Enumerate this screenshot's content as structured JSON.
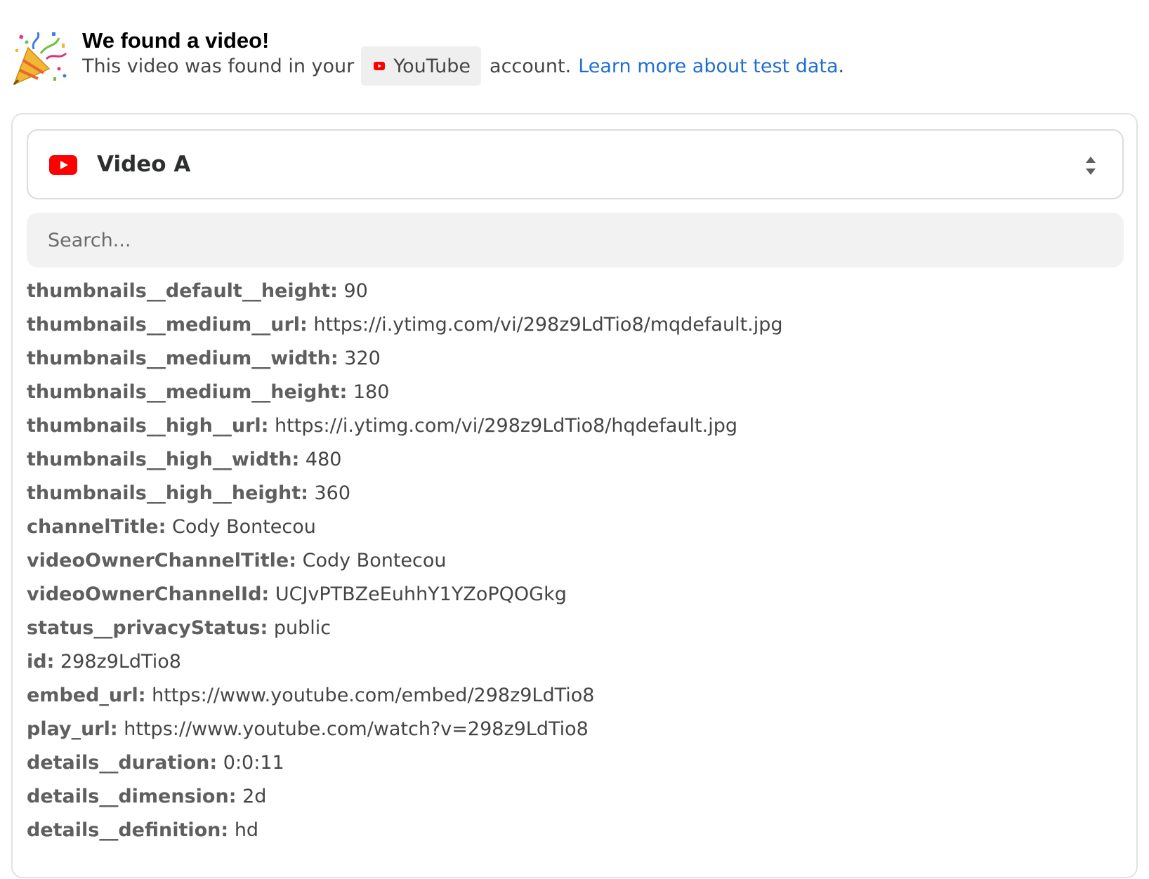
{
  "header": {
    "title": "We found a video!",
    "subtitle_prefix": "This video was found in your",
    "app_name": "YouTube",
    "subtitle_suffix": "account.",
    "link_text": "Learn more about test data",
    "link_period": ".",
    "icon": "party-popper-icon"
  },
  "selector": {
    "value": "Video A",
    "icon": "youtube-icon",
    "toggle_icon": "sort-arrows-icon"
  },
  "search": {
    "placeholder": "Search..."
  },
  "fields": [
    {
      "key": "thumbnails__default__height:",
      "value": "90"
    },
    {
      "key": "thumbnails__medium__url:",
      "value": "https://i.ytimg.com/vi/298z9LdTio8/mqdefault.jpg"
    },
    {
      "key": "thumbnails__medium__width:",
      "value": "320"
    },
    {
      "key": "thumbnails__medium__height:",
      "value": "180"
    },
    {
      "key": "thumbnails__high__url:",
      "value": "https://i.ytimg.com/vi/298z9LdTio8/hqdefault.jpg"
    },
    {
      "key": "thumbnails__high__width:",
      "value": "480"
    },
    {
      "key": "thumbnails__high__height:",
      "value": "360"
    },
    {
      "key": "channelTitle:",
      "value": "Cody Bontecou"
    },
    {
      "key": "videoOwnerChannelTitle:",
      "value": "Cody Bontecou"
    },
    {
      "key": "videoOwnerChannelId:",
      "value": "UCJvPTBZeEuhhY1YZoPQOGkg"
    },
    {
      "key": "status__privacyStatus:",
      "value": "public"
    },
    {
      "key": "id:",
      "value": "298z9LdTio8"
    },
    {
      "key": "embed_url:",
      "value": "https://www.youtube.com/embed/298z9LdTio8"
    },
    {
      "key": "play_url:",
      "value": "https://www.youtube.com/watch?v=298z9LdTio8"
    },
    {
      "key": "details__duration:",
      "value": "0:0:11"
    },
    {
      "key": "details__dimension:",
      "value": "2d"
    },
    {
      "key": "details__definition:",
      "value": "hd"
    }
  ],
  "colors": {
    "link": "#1f6fd1",
    "youtube_red": "#ff0000",
    "card_border": "#e2e2e2",
    "search_bg": "#f2f2f2"
  }
}
